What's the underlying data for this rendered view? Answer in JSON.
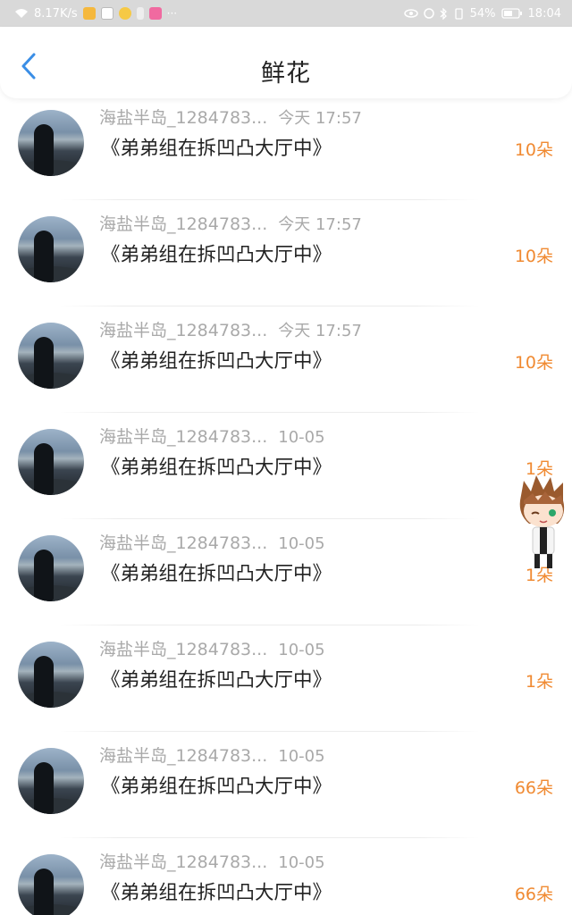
{
  "status_bar": {
    "network_speed": "8.17K/s",
    "battery_percent": "54%",
    "time": "18:04"
  },
  "header": {
    "title": "鲜花"
  },
  "colors": {
    "amount": "#f08a32",
    "meta": "#a9a9a9",
    "back_icon": "#3a8ee6"
  },
  "records": [
    {
      "user": "海盐半岛_1284783...",
      "date": "今天 17:57",
      "content": "《弟弟组在拆凹凸大厅中》",
      "amount": "10朵"
    },
    {
      "user": "海盐半岛_1284783...",
      "date": "今天 17:57",
      "content": "《弟弟组在拆凹凸大厅中》",
      "amount": "10朵"
    },
    {
      "user": "海盐半岛_1284783...",
      "date": "今天 17:57",
      "content": "《弟弟组在拆凹凸大厅中》",
      "amount": "10朵"
    },
    {
      "user": "海盐半岛_1284783...",
      "date": "10-05",
      "content": "《弟弟组在拆凹凸大厅中》",
      "amount": "1朵"
    },
    {
      "user": "海盐半岛_1284783...",
      "date": "10-05",
      "content": "《弟弟组在拆凹凸大厅中》",
      "amount": "1朵"
    },
    {
      "user": "海盐半岛_1284783...",
      "date": "10-05",
      "content": "《弟弟组在拆凹凸大厅中》",
      "amount": "1朵"
    },
    {
      "user": "海盐半岛_1284783...",
      "date": "10-05",
      "content": "《弟弟组在拆凹凸大厅中》",
      "amount": "66朵"
    },
    {
      "user": "海盐半岛_1284783...",
      "date": "10-05",
      "content": "《弟弟组在拆凹凸大厅中》",
      "amount": "66朵"
    }
  ]
}
